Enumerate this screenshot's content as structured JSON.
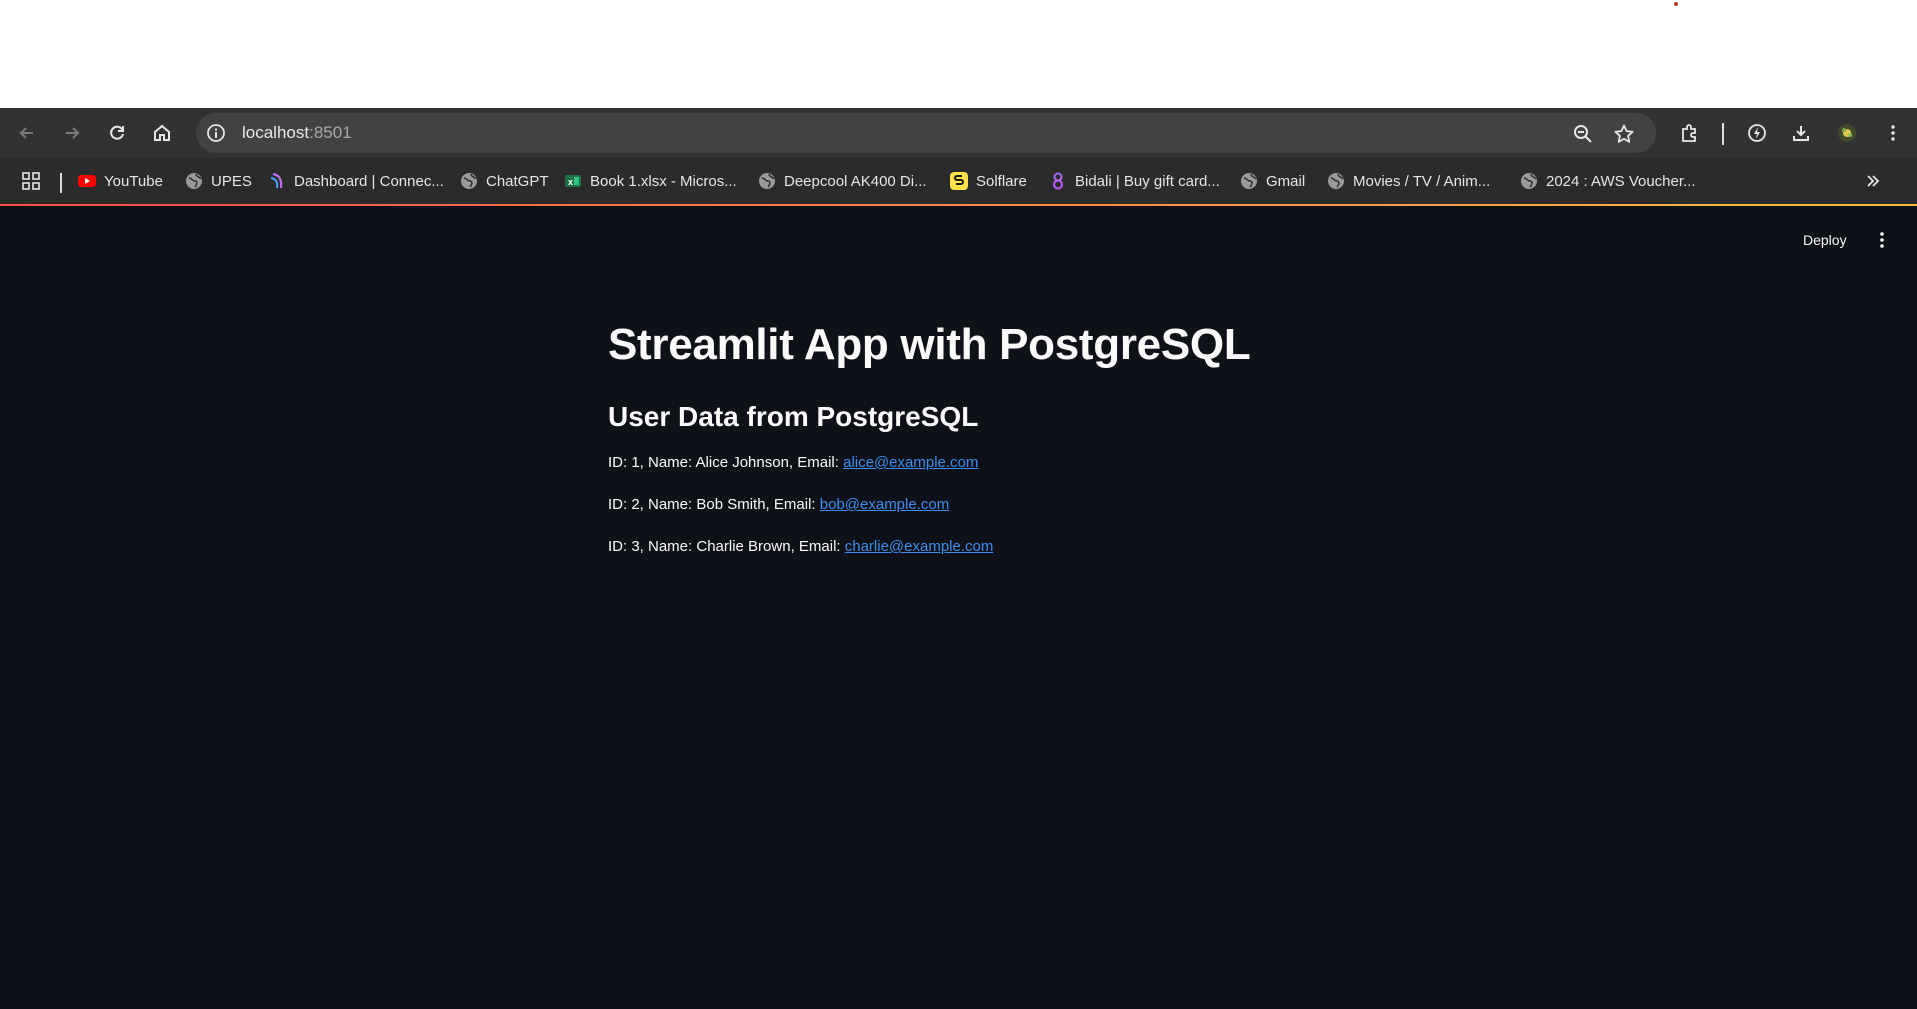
{
  "browser": {
    "url_host": "localhost",
    "url_port": ":8501"
  },
  "bookmarks": [
    {
      "label": "YouTube",
      "icon": "youtube-icon"
    },
    {
      "label": "UPES",
      "icon": "globe-icon"
    },
    {
      "label": "Dashboard | Connec...",
      "icon": "dashboard-favicon-icon"
    },
    {
      "label": "ChatGPT",
      "icon": "globe-icon"
    },
    {
      "label": "Book 1.xlsx - Micros...",
      "icon": "excel-icon"
    },
    {
      "label": "Deepcool AK400 Di...",
      "icon": "globe-icon"
    },
    {
      "label": "Solflare",
      "icon": "solflare-icon"
    },
    {
      "label": "Bidali | Buy gift card...",
      "icon": "bidali-icon"
    },
    {
      "label": "Gmail",
      "icon": "globe-icon"
    },
    {
      "label": "Movies / TV / Anim...",
      "icon": "globe-icon"
    },
    {
      "label": "2024 : AWS Voucher...",
      "icon": "globe-icon"
    }
  ],
  "app": {
    "deploy_label": "Deploy",
    "title": "Streamlit App with PostgreSQL",
    "subtitle": "User Data from PostgreSQL",
    "users": [
      {
        "text": "ID: 1, Name: Alice Johnson, Email: ",
        "email": "alice@example.com"
      },
      {
        "text": "ID: 2, Name: Bob Smith, Email: ",
        "email": "bob@example.com"
      },
      {
        "text": "ID: 3, Name: Charlie Brown, Email: ",
        "email": "charlie@example.com"
      }
    ]
  },
  "colors": {
    "app_background": "#0e1117",
    "link": "#3b8df0",
    "chrome_toolbar": "#323232"
  }
}
